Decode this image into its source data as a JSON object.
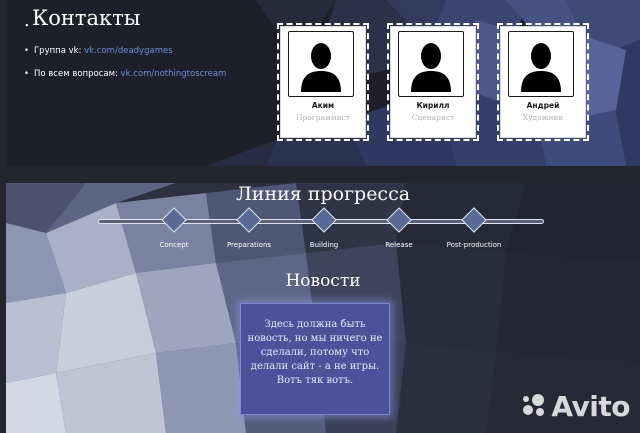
{
  "contacts": {
    "title": "Контакты",
    "bullet": ".",
    "lines": [
      {
        "label": "Группа vk:",
        "link": "vk.com/deadygames"
      },
      {
        "label": "По всем вопросам:",
        "link": "vk.com/nothingtoscream"
      }
    ]
  },
  "team": [
    {
      "name": "Аким",
      "role": "Программист"
    },
    {
      "name": "Кирилл",
      "role": "Сценарист"
    },
    {
      "name": "Андрей",
      "role": "Художник"
    }
  ],
  "progress": {
    "title": "Линия прогресса",
    "milestones": [
      "Concept",
      "Preparations",
      "Building",
      "Release",
      "Post-production"
    ]
  },
  "news": {
    "title": "Новости",
    "text": "Здесь должна быть новость, но мы ничего не сделали, потому что делали сайт - а не игры. Вотъ тяк вотъ."
  },
  "watermark": {
    "icon": "avito-logo-icon",
    "text": "Avito"
  },
  "colors": {
    "top_bg": "#1d1f2a",
    "bottom_bg": "#2c3040",
    "link": "#6b8fd6",
    "milestone": "#596a97",
    "news_box": "#4a5399"
  }
}
